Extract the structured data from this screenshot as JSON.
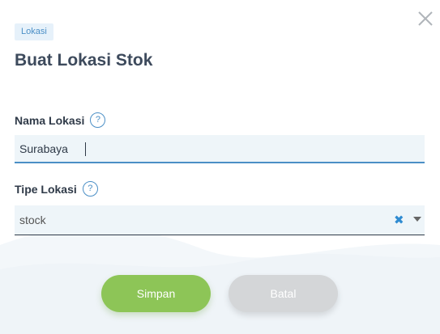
{
  "dialog": {
    "tag": "Lokasi",
    "title": "Buat Lokasi Stok"
  },
  "fields": {
    "name": {
      "label": "Nama Lokasi",
      "help": "?",
      "value": "Surabaya"
    },
    "type": {
      "label": "Tipe Lokasi",
      "help": "?",
      "value": "stock",
      "clear_glyph": "✖"
    }
  },
  "actions": {
    "save": "Simpan",
    "cancel": "Batal"
  },
  "colors": {
    "accent": "#4b8fc6",
    "save": "#8dc557",
    "cancel": "#d4d6d8"
  },
  "icons": [
    "close-icon",
    "help-icon",
    "clear-icon",
    "chevron-down-icon"
  ]
}
